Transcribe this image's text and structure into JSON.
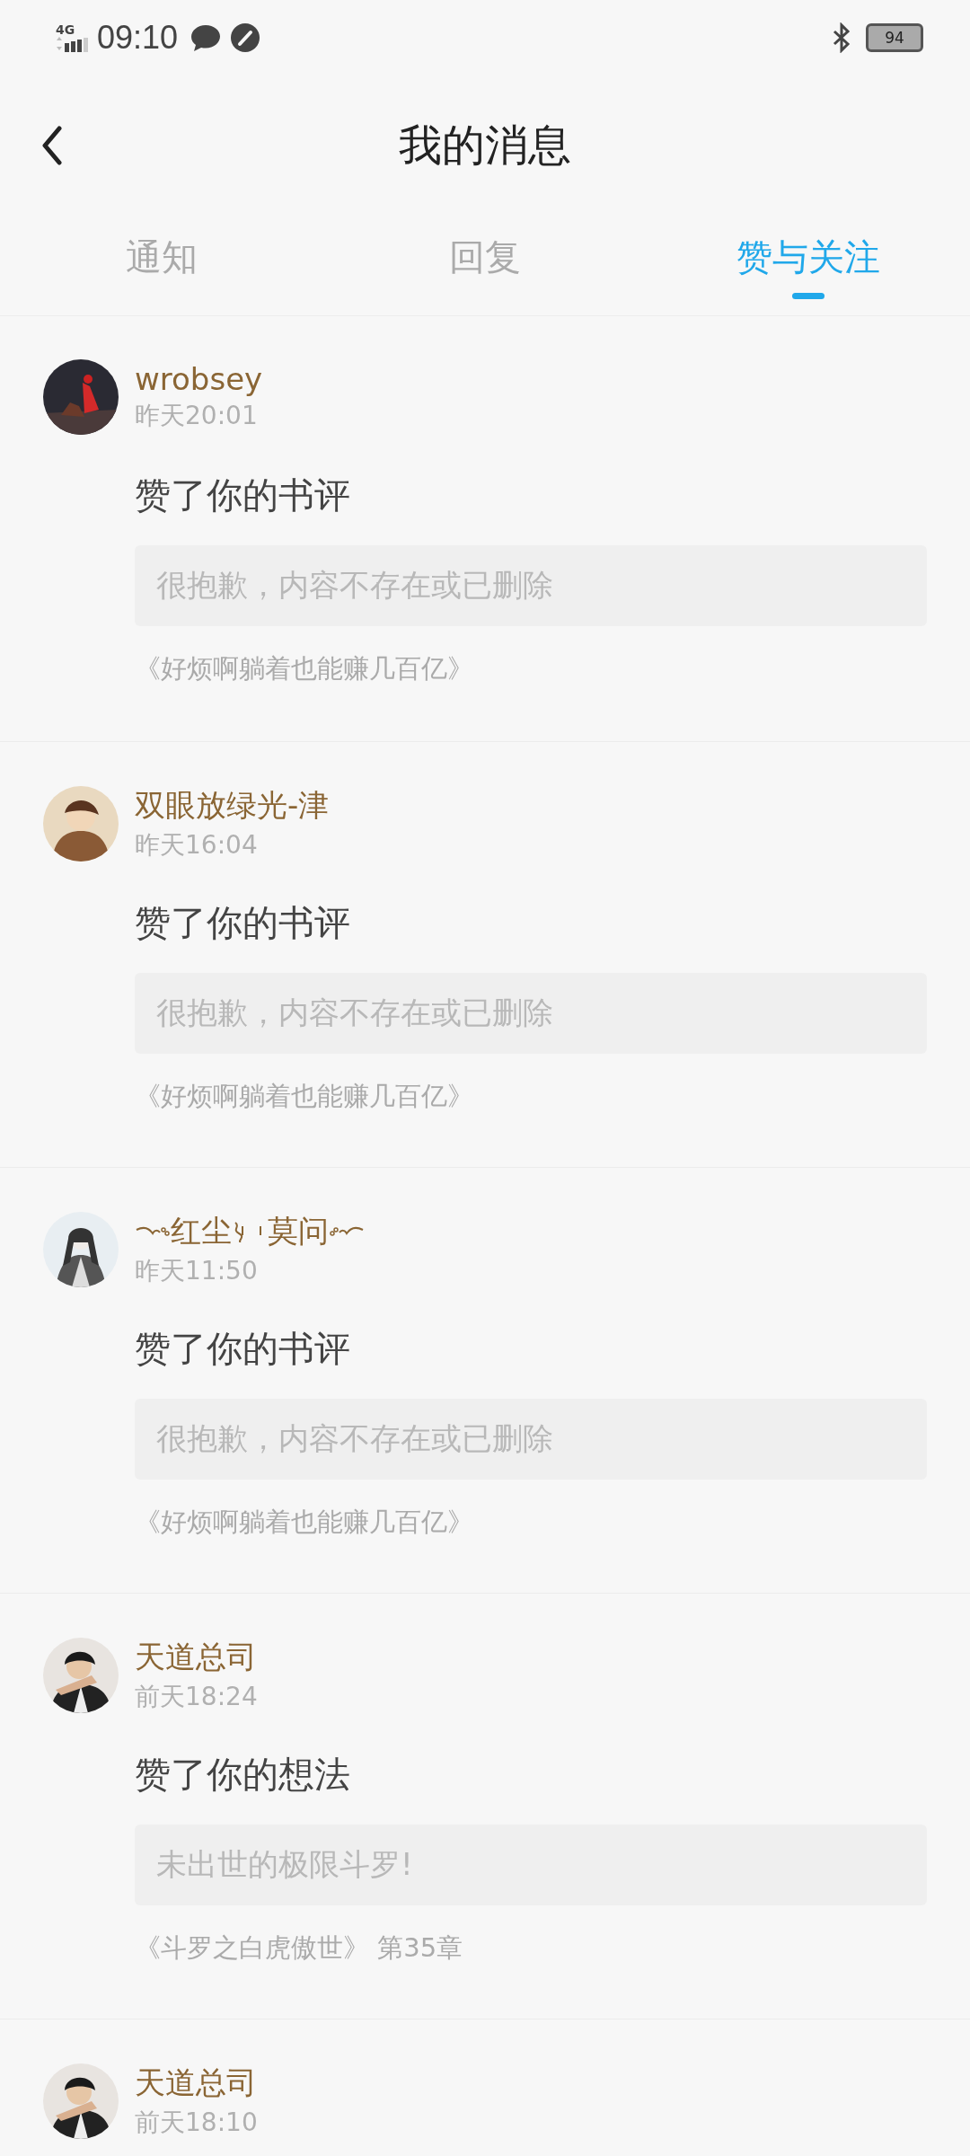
{
  "status_bar": {
    "network": "4G",
    "time": "09:10",
    "battery": "94"
  },
  "header": {
    "title": "我的消息"
  },
  "tabs": [
    {
      "label": "通知",
      "selected": false
    },
    {
      "label": "回复",
      "selected": false
    },
    {
      "label": "赞与关注",
      "selected": true
    }
  ],
  "messages": [
    {
      "name_parts": [
        "wrobsey"
      ],
      "ornate": false,
      "time": "昨天20:01",
      "action": "赞了你的书评",
      "quote": "很抱歉，内容不存在或已删除",
      "source": "《好烦啊躺着也能赚几百亿》"
    },
    {
      "name_parts": [
        "双眼放绿光-津"
      ],
      "ornate": false,
      "time": "昨天16:04",
      "action": "赞了你的书评",
      "quote": "很抱歉，内容不存在或已删除",
      "source": "《好烦啊躺着也能赚几百亿》"
    },
    {
      "name_parts": [
        "红尘",
        "莫问"
      ],
      "ornate": true,
      "time": "昨天11:50",
      "action": "赞了你的书评",
      "quote": "很抱歉，内容不存在或已删除",
      "source": "《好烦啊躺着也能赚几百亿》"
    },
    {
      "name_parts": [
        "天道总司"
      ],
      "ornate": false,
      "time": "前天18:24",
      "action": "赞了你的想法",
      "quote": "未出世的极限斗罗!",
      "source": "《斗罗之白虎傲世》 第35章"
    },
    {
      "name_parts": [
        "天道总司"
      ],
      "ornate": false,
      "time": "前天18:10"
    }
  ]
}
